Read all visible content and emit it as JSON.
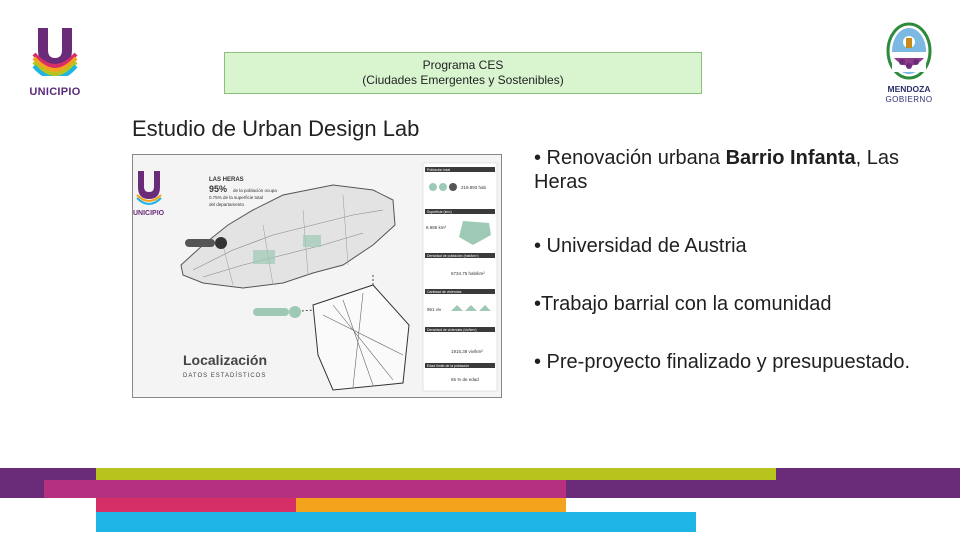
{
  "logo_left": {
    "wordmark": "UNICIPIO"
  },
  "banner": {
    "line1": "Programa CES",
    "line2": "(Ciudades Emergentes y Sostenibles)"
  },
  "logo_right": {
    "name": "MENDOZA",
    "sub": "GOBIERNO"
  },
  "study_title": "Estudio de Urban Design Lab",
  "poster": {
    "brand": "UNICIPIO",
    "heading_line1": "LAS HERAS",
    "heading_pct": "95%",
    "heading_rest1": "de la población ocupa",
    "heading_rest2": "0.75% de la superficie total",
    "heading_rest3": "del departamento",
    "title": "Localización",
    "subtitle": "DATOS ESTADÍSTICOS",
    "sidebar_headers": [
      "Población total",
      "Superficie (km²)",
      "Densidad de población (hab/km²)",
      "Cantidad de viviendas",
      "Densidad de viviendas (viv/km²)",
      "Edad límite de la población"
    ],
    "sidebar_values": [
      "219.893 hab",
      "8.985 km²",
      "6734.75 hab/km²",
      "961 viv",
      "1915,38 viv/km²",
      "65 % de edad"
    ]
  },
  "bullets": {
    "b1_prefix": "• Renovación urbana ",
    "b1_strong": "Barrio Infanta",
    "b1_suffix": ", Las Heras",
    "b2": "• Universidad de Austria",
    "b3": "•Trabajo barrial con la comunidad",
    "b4": "• Pre-proyecto finalizado y presupuestado."
  },
  "colors": {
    "purple": "#6a2b78",
    "lime": "#b8c41e",
    "magenta": "#b5317f",
    "orange": "#f4a31c",
    "cyan": "#1fb4e6",
    "pink": "#d62f68"
  }
}
